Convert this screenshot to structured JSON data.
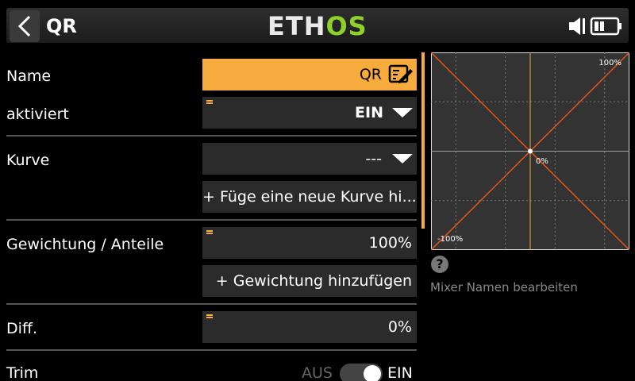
{
  "header": {
    "title": "QR",
    "logo_left": "ETH",
    "logo_right": "OS"
  },
  "form": {
    "name_label": "Name",
    "name_value": "QR",
    "enabled_label": "aktiviert",
    "enabled_value": "EIN",
    "curve_label": "Kurve",
    "curve_value": "---",
    "add_curve_button": "+ Füge eine neue Kurve hi...",
    "weight_label": "Gewichtung / Anteile",
    "weight_value": "100%",
    "add_weight_button": "+ Gewichtung hinzufügen",
    "diff_label": "Diff.",
    "diff_value": "0%",
    "trim_label": "Trim",
    "trim_off": "AUS",
    "trim_on": "EIN"
  },
  "chart_data": {
    "type": "line",
    "series": [
      {
        "values": [
          [
            -100,
            -100
          ],
          [
            100,
            100
          ]
        ],
        "color": "#e8531a"
      },
      {
        "values": [
          [
            -100,
            100
          ],
          [
            100,
            -100
          ]
        ],
        "color": "#e8531a"
      }
    ],
    "labels": {
      "top_right": "100%",
      "bottom_left": "-100%",
      "center": "0%"
    },
    "xlim": [
      -100,
      100
    ],
    "ylim": [
      -100,
      100
    ],
    "grid": true,
    "center_line_color": "#f6ab3c",
    "line_color": "#e8531a"
  },
  "help": {
    "icon": "?",
    "text": "Mixer Namen bearbeiten"
  },
  "colors": {
    "accent": "#f6ab3c",
    "logo_green": "#8ed12a"
  }
}
